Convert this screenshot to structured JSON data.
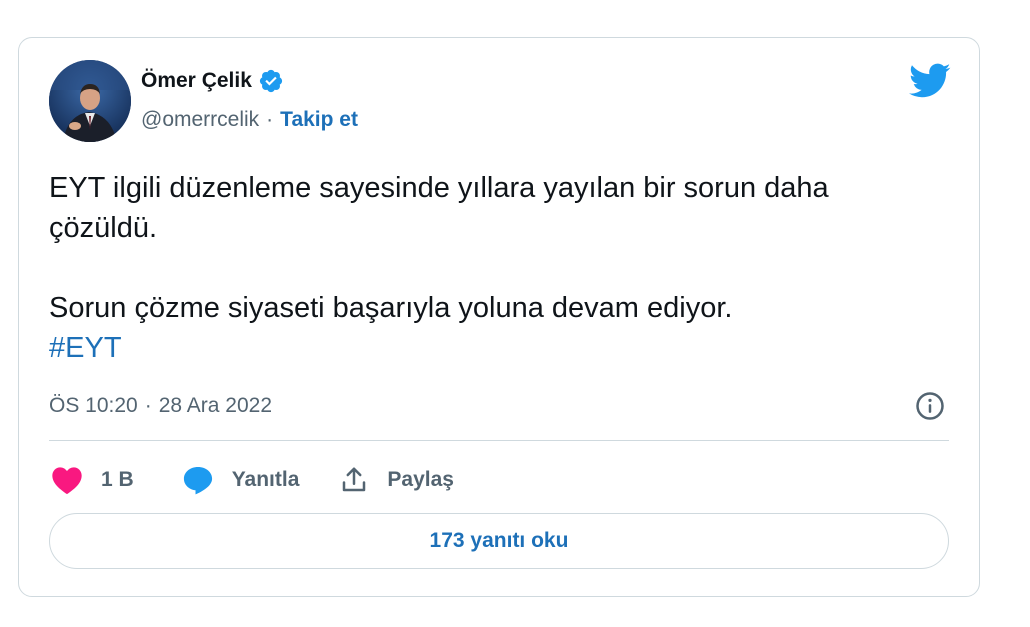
{
  "tweet": {
    "author": {
      "name": "Ömer Çelik",
      "handle": "@omerrcelik",
      "verified": true,
      "separator": "·",
      "follow_label": "Takip et"
    },
    "text": {
      "line1": "EYT ilgili düzenleme sayesinde yıllara yayılan bir sorun daha çözüldü.",
      "line2": "Sorun çözme siyaseti başarıyla yoluna devam ediyor.",
      "hashtag": "#EYT"
    },
    "meta": {
      "time": "ÖS 10:20",
      "separator": "·",
      "date": "28 Ara 2022"
    },
    "actions": {
      "like_count": "1 B",
      "reply_label": "Yanıtla",
      "share_label": "Paylaş"
    },
    "read_replies_label": "173 yanıtı oku"
  },
  "icons": {
    "twitter_logo": "twitter-bird-icon",
    "verified": "verified-badge-icon",
    "info": "info-icon",
    "like": "heart-icon",
    "reply": "speech-bubble-icon",
    "share": "share-upload-icon"
  },
  "colors": {
    "brand_blue": "#1d9bf0",
    "link_blue": "#1d70b8",
    "heart_pink": "#f91880",
    "text": "#0f1419",
    "secondary": "#536471",
    "border": "#cfd9de"
  }
}
